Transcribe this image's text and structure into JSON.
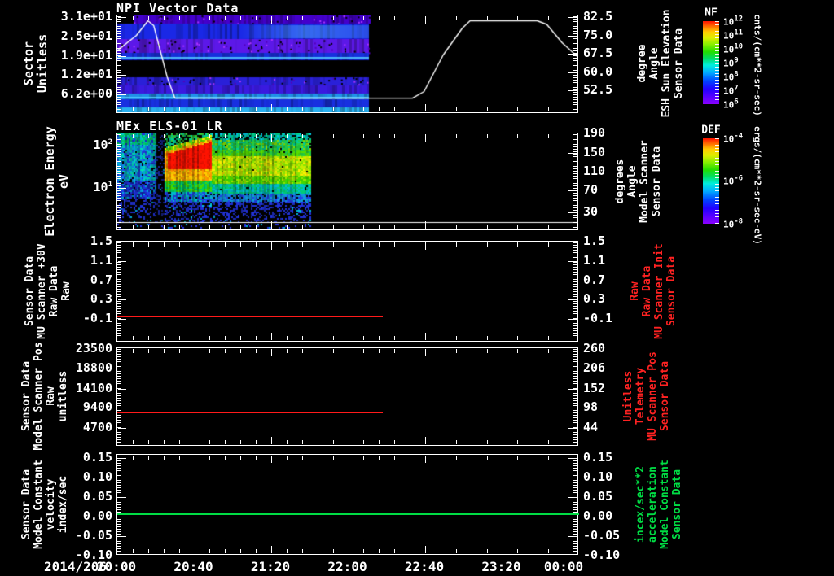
{
  "figure": {
    "x_axis": {
      "date_label": "2014/206",
      "tick_labels": [
        "20:00",
        "20:40",
        "21:20",
        "22:00",
        "22:40",
        "23:20",
        "00:00"
      ]
    },
    "colors": {
      "background": "#000000",
      "axis": "#ffffff",
      "red_series": "#ff1a1a",
      "green_series": "#00dd44",
      "red_label": "#ff2222",
      "green_label": "#00dd44"
    }
  },
  "panels": [
    {
      "title": "NPI Vector Data",
      "left_label_lines": [
        "Sector",
        "Unitless"
      ],
      "left_tick_labels": [
        "3.1e+01",
        "2.5e+01",
        "1.9e+01",
        "1.2e+01",
        "6.2e+00"
      ],
      "right_tick_labels": [
        "82.5",
        "75.0",
        "67.5",
        "60.0",
        "52.5"
      ],
      "right_label_lines": [
        "Sensor Data",
        "ESH Sun Elevation",
        "Angle",
        "degree"
      ],
      "colorbar": {
        "name": "NF",
        "tick_base": "10",
        "tick_exponents": [
          "12",
          "11",
          "10",
          "9",
          "8",
          "7",
          "6"
        ],
        "units": "cnts/(cm**2-sr-sec)"
      }
    },
    {
      "title": "MEx ELS-01 LR",
      "left_label_lines": [
        "Electron Energy",
        "eV"
      ],
      "left_tick_base": "10",
      "left_tick_exponents": [
        "2",
        "1"
      ],
      "right_tick_labels": [
        "190",
        "150",
        "110",
        "70",
        "30"
      ],
      "right_label_lines": [
        "Sensor Data",
        "Model Scanner",
        "Angle",
        "degrees"
      ],
      "colorbar": {
        "name": "DEF",
        "tick_base": "10",
        "tick_exponents": [
          "-4",
          "-6",
          "-8"
        ],
        "units": "ergs/(cm**2-sr-sec-eV)"
      }
    },
    {
      "left_label_lines": [
        "Sensor Data",
        "MU Scanner +30V",
        "Raw Data",
        "Raw"
      ],
      "left_tick_labels": [
        "1.5",
        "1.1",
        "0.7",
        "0.3",
        "-0.1"
      ],
      "right_tick_labels": [
        "1.5",
        "1.1",
        "0.7",
        "0.3",
        "-0.1"
      ],
      "right_label_lines": [
        "Sensor Data",
        "MU Scanner Init",
        "Raw Data",
        "Raw"
      ]
    },
    {
      "left_label_lines": [
        "Sensor Data",
        "Model Scanner Pos",
        "Raw",
        "unitless"
      ],
      "left_tick_labels": [
        "23500",
        "18800",
        "14100",
        "9400",
        "4700"
      ],
      "right_tick_labels": [
        "260",
        "206",
        "152",
        "98",
        "44"
      ],
      "right_label_lines": [
        "Sensor Data",
        "MU Scanner Pos",
        "Telemetry",
        "Unitless"
      ]
    },
    {
      "left_label_lines": [
        "Sensor Data",
        "Model Constant",
        "velocity",
        "index/sec"
      ],
      "left_tick_labels": [
        "0.15",
        "0.10",
        "0.05",
        "0.00",
        "-0.05",
        "-0.10"
      ],
      "right_tick_labels": [
        "0.15",
        "0.10",
        "0.05",
        "0.00",
        "-0.05",
        "-0.10"
      ],
      "right_label_lines": [
        "Sensor Data",
        "Model Constant",
        "acceleration",
        "incex/sec**2"
      ]
    }
  ],
  "chart_data": [
    {
      "type": "heatmap",
      "title": "NPI Vector Data",
      "ylabel": "Sector Unitless",
      "y_ticks": [
        "3.1e+01",
        "2.5e+01",
        "1.9e+01",
        "1.2e+01",
        "6.2e+00"
      ],
      "y_range_sectors": [
        0,
        32
      ],
      "x_ticks": [
        "20:00",
        "20:40",
        "21:20",
        "22:00",
        "22:40",
        "23:20",
        "00:00"
      ],
      "data_time_extent": [
        "20:00",
        "22:10"
      ],
      "bands": [
        {
          "sectors": [
            29.3,
            32
          ],
          "color": "#4400cc",
          "texture": "speckled",
          "starts": "20:09"
        },
        {
          "sectors": [
            24.2,
            29.3
          ],
          "color": "#1a28e6",
          "texture": "streaky cyan glow after 21:00"
        },
        {
          "sectors": [
            19.5,
            24.2
          ],
          "color": "#5c18e8",
          "texture": "speckled magenta"
        },
        {
          "sectors": [
            17.2,
            19.5
          ],
          "color": "#1630dd",
          "texture": "streaky",
          "streak_sector": 18.2
        },
        {
          "sectors": [
            11.6,
            17.2
          ],
          "color": "#000000",
          "texture": "gap"
        },
        {
          "sectors": [
            9.0,
            11.6
          ],
          "color": "#2a20d8",
          "texture": "speckled"
        },
        {
          "sectors": [
            6.3,
            9.0
          ],
          "color": "#3a1ae0",
          "texture": "streaky"
        },
        {
          "sectors": [
            4.2,
            6.3
          ],
          "color": "#2090e8",
          "texture": "streaky",
          "streak_sector": 5.2
        },
        {
          "sectors": [
            1.6,
            4.2
          ],
          "color": "#1830e0",
          "texture": "streaky"
        },
        {
          "sectors": [
            0,
            1.6
          ],
          "color": "#28b0f0",
          "texture": "bright"
        }
      ],
      "overlay_line": {
        "label": "Sensor Data ESH Sun Elevation Angle degree",
        "color": "#ffffff",
        "right_ticks_deg": [
          82.5,
          75.0,
          67.5,
          60.0,
          52.5
        ],
        "points_time_deg": [
          [
            "20:00",
            68.8
          ],
          [
            "20:10",
            75
          ],
          [
            "20:16",
            81
          ],
          [
            "20:19",
            79
          ],
          [
            "20:26",
            58
          ],
          [
            "20:30",
            49.3
          ],
          [
            "22:34",
            49.3
          ],
          [
            "22:40",
            52
          ],
          [
            "22:50",
            67
          ],
          [
            "23:00",
            78
          ],
          [
            "23:04",
            81
          ],
          [
            "23:39",
            81
          ],
          [
            "23:44",
            79.5
          ],
          [
            "23:52",
            72
          ],
          [
            "00:00",
            66.3
          ]
        ]
      },
      "colorbar": {
        "name": "NF",
        "log10_range": [
          6,
          12
        ],
        "units": "cnts/(cm**2-sr-sec)"
      }
    },
    {
      "type": "spectrogram",
      "title": "MEx ELS-01 LR",
      "ylabel": "Electron Energy eV",
      "y_scale": "log",
      "y_ticks_eV": [
        100,
        10
      ],
      "data_time_extent": [
        "20:00",
        "21:40"
      ],
      "features": [
        {
          "name": "ambient noise",
          "time": [
            "20:00",
            "20:20"
          ],
          "energy_eV": [
            3,
            150
          ],
          "appearance": "cyan-blue speckle"
        },
        {
          "name": "intense beam",
          "time": [
            "20:25",
            "20:49"
          ],
          "energy_eV": [
            30,
            130
          ],
          "appearance": "saturated red with orange-yellow fringe"
        },
        {
          "name": "energetic band",
          "time": [
            "20:49",
            "21:40"
          ],
          "energy_eV": [
            20,
            70
          ],
          "appearance": "green band with yellow core"
        },
        {
          "name": "low-energy speckle strip",
          "time": [
            "20:00",
            "21:40"
          ],
          "energy_eV": [
            2,
            4
          ],
          "appearance": "sparse blue speckle below white separator"
        }
      ],
      "right_axis": {
        "label": "Sensor Data Model Scanner Angle degrees",
        "ticks": [
          190,
          150,
          110,
          70,
          30
        ]
      },
      "colorbar": {
        "name": "DEF",
        "log10_range": [
          -8,
          -4
        ],
        "units": "ergs/(cm**2-sr-sec-eV)"
      }
    },
    {
      "type": "line",
      "left_label": "Sensor Data MU Scanner +30V Raw Data Raw",
      "right_label": "Sensor Data MU Scanner Init Raw Data Raw",
      "y_ticks": [
        1.5,
        1.1,
        0.7,
        0.3,
        -0.1
      ],
      "ylim": [
        -0.5,
        1.5
      ],
      "series": [
        {
          "name": "MU Scanner +30V Raw",
          "color": "#ff1a1a",
          "value": 0.0,
          "time_extent": [
            "20:00",
            "22:18"
          ]
        }
      ]
    },
    {
      "type": "line",
      "left_label": "Sensor Data Model Scanner Pos Raw unitless",
      "right_axis": {
        "label": "Sensor Data MU Scanner Pos Telemetry Unitless",
        "ticks": [
          260,
          206,
          152,
          98,
          44
        ]
      },
      "y_ticks": [
        23500,
        18800,
        14100,
        9400,
        4700
      ],
      "ylim": [
        0,
        23500
      ],
      "series": [
        {
          "name": "Model Scanner Pos Raw",
          "color": "#ff1a1a",
          "value": 7900,
          "time_extent": [
            "20:00",
            "22:18"
          ]
        }
      ]
    },
    {
      "type": "line",
      "left_label": "Sensor Data Model Constant velocity index/sec",
      "right_axis": {
        "label": "Sensor Data Model Constant acceleration incex/sec**2",
        "ticks": [
          0.15,
          0.1,
          0.05,
          0.0,
          -0.05,
          -0.1
        ]
      },
      "y_ticks": [
        0.15,
        0.1,
        0.05,
        0.0,
        -0.05,
        -0.1
      ],
      "ylim": [
        -0.1,
        0.15
      ],
      "series": [
        {
          "name": "Model Constant velocity",
          "color": "#00dd44",
          "value": 0.0,
          "time_extent": [
            "20:00",
            "00:00"
          ]
        }
      ]
    }
  ]
}
